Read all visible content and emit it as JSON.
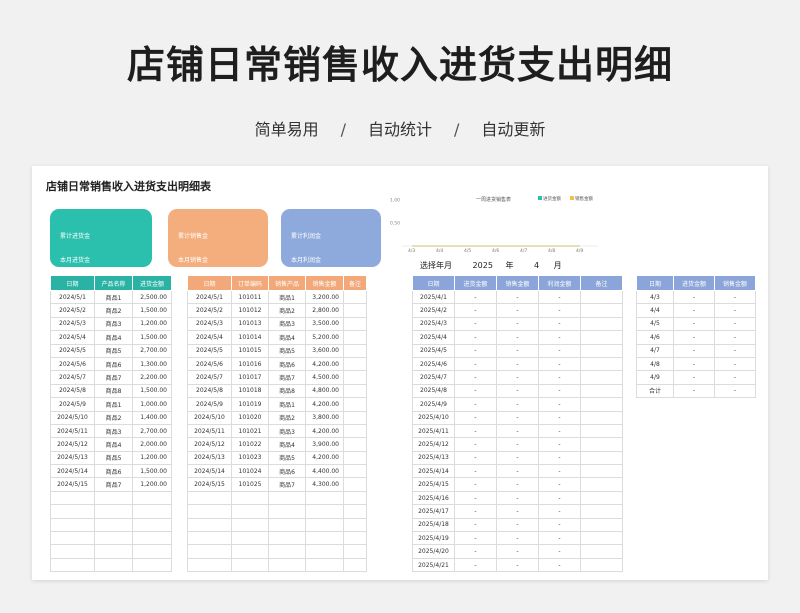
{
  "hero": {
    "title": "店铺日常销售收入进货支出明细",
    "tags": [
      "简单易用",
      "自动统计",
      "自动更新"
    ],
    "separator": "/"
  },
  "sheet": {
    "title": "店铺日常销售收入进货支出明细表"
  },
  "cards": [
    {
      "line1": "累计进货金",
      "line2": "本月进货金",
      "color": "#2bbfae"
    },
    {
      "line1": "累计销售金",
      "line2": "本月销售金",
      "color": "#f4ae7d"
    },
    {
      "line1": "累计利润金",
      "line2": "本月利润金",
      "color": "#8eaadd"
    }
  ],
  "chart_data": {
    "type": "line",
    "title": "一周进货销售表",
    "series": [
      {
        "name": "进货金额",
        "color": "#2bbfae",
        "values": [
          0,
          0,
          0,
          0,
          0,
          0,
          0
        ]
      },
      {
        "name": "销售金额",
        "color": "#f4c04e",
        "values": [
          0,
          0,
          0,
          0,
          0,
          0,
          0
        ]
      }
    ],
    "categories": [
      "4/3",
      "4/4",
      "4/5",
      "4/6",
      "4/7",
      "4/8",
      "4/9"
    ],
    "y_ticks": [
      "1.00",
      "0.50"
    ],
    "legend": "top-right"
  },
  "selector": {
    "label": "选择年月",
    "year": "2025",
    "year_unit": "年",
    "month": "4",
    "month_unit": "月"
  },
  "purchase": {
    "headers": [
      "日期",
      "产品名称",
      "进货金额"
    ],
    "rows": [
      [
        "2024/5/1",
        "商品1",
        "2,500.00"
      ],
      [
        "2024/5/2",
        "商品2",
        "1,500.00"
      ],
      [
        "2024/5/3",
        "商品3",
        "1,200.00"
      ],
      [
        "2024/5/4",
        "商品4",
        "1,500.00"
      ],
      [
        "2024/5/5",
        "商品5",
        "2,700.00"
      ],
      [
        "2024/5/6",
        "商品6",
        "1,300.00"
      ],
      [
        "2024/5/7",
        "商品7",
        "2,200.00"
      ],
      [
        "2024/5/8",
        "商品8",
        "1,500.00"
      ],
      [
        "2024/5/9",
        "商品1",
        "1,000.00"
      ],
      [
        "2024/5/10",
        "商品2",
        "1,400.00"
      ],
      [
        "2024/5/11",
        "商品3",
        "2,700.00"
      ],
      [
        "2024/5/12",
        "商品4",
        "2,000.00"
      ],
      [
        "2024/5/13",
        "商品5",
        "1,200.00"
      ],
      [
        "2024/5/14",
        "商品6",
        "1,500.00"
      ],
      [
        "2024/5/15",
        "商品7",
        "1,200.00"
      ],
      [
        "",
        "",
        ""
      ],
      [
        "",
        "",
        ""
      ],
      [
        "",
        "",
        ""
      ],
      [
        "",
        "",
        ""
      ],
      [
        "",
        "",
        ""
      ],
      [
        "",
        "",
        ""
      ]
    ]
  },
  "sales": {
    "headers": [
      "日期",
      "订单编码",
      "销售产品",
      "销售金额",
      "备注"
    ],
    "rows": [
      [
        "2024/5/1",
        "101011",
        "商品1",
        "3,200.00",
        ""
      ],
      [
        "2024/5/2",
        "101012",
        "商品2",
        "2,800.00",
        ""
      ],
      [
        "2024/5/3",
        "101013",
        "商品3",
        "3,500.00",
        ""
      ],
      [
        "2024/5/4",
        "101014",
        "商品4",
        "5,200.00",
        ""
      ],
      [
        "2024/5/5",
        "101015",
        "商品5",
        "3,600.00",
        ""
      ],
      [
        "2024/5/6",
        "101016",
        "商品6",
        "4,200.00",
        ""
      ],
      [
        "2024/5/7",
        "101017",
        "商品7",
        "4,500.00",
        ""
      ],
      [
        "2024/5/8",
        "101018",
        "商品8",
        "4,800.00",
        ""
      ],
      [
        "2024/5/9",
        "101019",
        "商品1",
        "4,200.00",
        ""
      ],
      [
        "2024/5/10",
        "101020",
        "商品2",
        "3,800.00",
        ""
      ],
      [
        "2024/5/11",
        "101021",
        "商品3",
        "4,200.00",
        ""
      ],
      [
        "2024/5/12",
        "101022",
        "商品4",
        "3,900.00",
        ""
      ],
      [
        "2024/5/13",
        "101023",
        "商品5",
        "4,200.00",
        ""
      ],
      [
        "2024/5/14",
        "101024",
        "商品6",
        "4,400.00",
        ""
      ],
      [
        "2024/5/15",
        "101025",
        "商品7",
        "4,300.00",
        ""
      ],
      [
        "",
        "",
        "",
        "",
        ""
      ],
      [
        "",
        "",
        "",
        "",
        ""
      ],
      [
        "",
        "",
        "",
        "",
        ""
      ],
      [
        "",
        "",
        "",
        "",
        ""
      ],
      [
        "",
        "",
        "",
        "",
        ""
      ],
      [
        "",
        "",
        "",
        "",
        ""
      ]
    ]
  },
  "monthly": {
    "headers": [
      "日期",
      "进货金额",
      "销售金额",
      "利润金额",
      "备注"
    ],
    "rows": [
      [
        "2025/4/1",
        "-",
        "-",
        "-",
        ""
      ],
      [
        "2025/4/2",
        "-",
        "-",
        "-",
        ""
      ],
      [
        "2025/4/3",
        "-",
        "-",
        "-",
        ""
      ],
      [
        "2025/4/4",
        "-",
        "-",
        "-",
        ""
      ],
      [
        "2025/4/5",
        "-",
        "-",
        "-",
        ""
      ],
      [
        "2025/4/6",
        "-",
        "-",
        "-",
        ""
      ],
      [
        "2025/4/7",
        "-",
        "-",
        "-",
        ""
      ],
      [
        "2025/4/8",
        "-",
        "-",
        "-",
        ""
      ],
      [
        "2025/4/9",
        "-",
        "-",
        "-",
        ""
      ],
      [
        "2025/4/10",
        "-",
        "-",
        "-",
        ""
      ],
      [
        "2025/4/11",
        "-",
        "-",
        "-",
        ""
      ],
      [
        "2025/4/12",
        "-",
        "-",
        "-",
        ""
      ],
      [
        "2025/4/13",
        "-",
        "-",
        "-",
        ""
      ],
      [
        "2025/4/14",
        "-",
        "-",
        "-",
        ""
      ],
      [
        "2025/4/15",
        "-",
        "-",
        "-",
        ""
      ],
      [
        "2025/4/16",
        "-",
        "-",
        "-",
        ""
      ],
      [
        "2025/4/17",
        "-",
        "-",
        "-",
        ""
      ],
      [
        "2025/4/18",
        "-",
        "-",
        "-",
        ""
      ],
      [
        "2025/4/19",
        "-",
        "-",
        "-",
        ""
      ],
      [
        "2025/4/20",
        "-",
        "-",
        "-",
        ""
      ],
      [
        "2025/4/21",
        "-",
        "-",
        "-",
        ""
      ]
    ]
  },
  "weekly": {
    "headers": [
      "日期",
      "进货金额",
      "销售金额"
    ],
    "rows": [
      [
        "4/3",
        "-",
        "-"
      ],
      [
        "4/4",
        "-",
        "-"
      ],
      [
        "4/5",
        "-",
        "-"
      ],
      [
        "4/6",
        "-",
        "-"
      ],
      [
        "4/7",
        "-",
        "-"
      ],
      [
        "4/8",
        "-",
        "-"
      ],
      [
        "4/9",
        "-",
        "-"
      ],
      [
        "合计",
        "-",
        "-"
      ]
    ]
  }
}
